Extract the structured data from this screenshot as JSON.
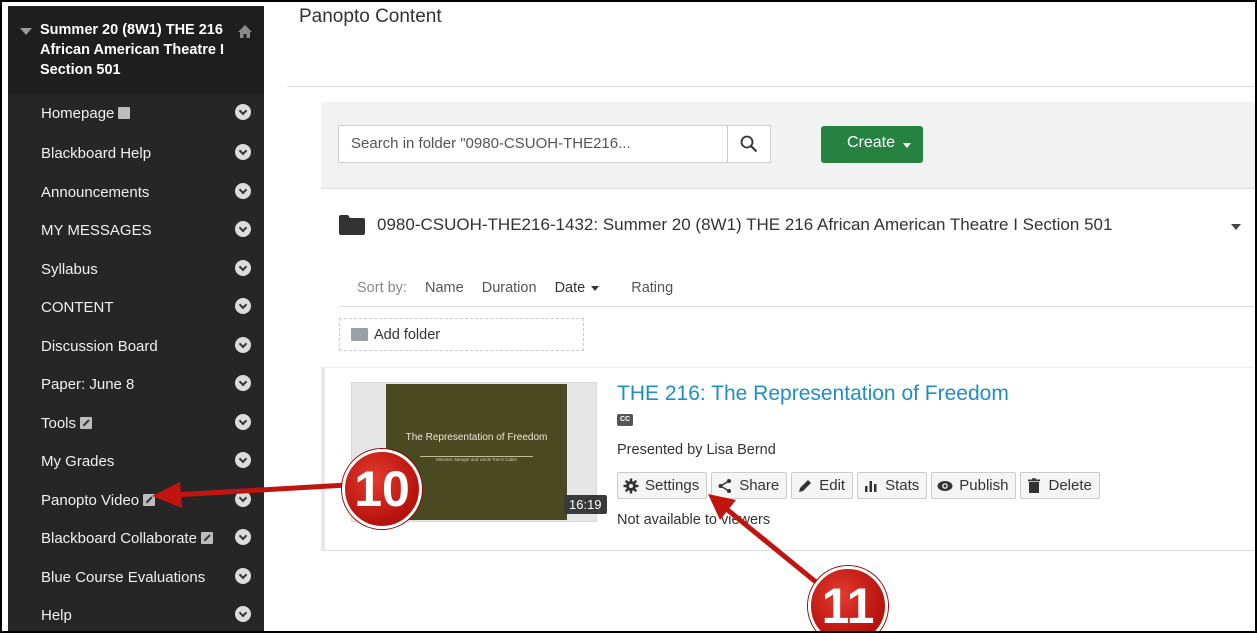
{
  "sidebar": {
    "course_title": "Summer 20 (8W1) THE 216 African American Theatre I Section 501",
    "items": [
      {
        "label": "Homepage",
        "icon": "page-icon"
      },
      {
        "label": "Blackboard Help"
      },
      {
        "label": "Announcements"
      },
      {
        "label": "MY MESSAGES"
      },
      {
        "label": "Syllabus"
      },
      {
        "label": "CONTENT"
      },
      {
        "label": "Discussion Board"
      },
      {
        "label": "Paper: June 8"
      },
      {
        "label": "Tools",
        "icon": "external-link-icon"
      },
      {
        "label": "My Grades"
      },
      {
        "label": "Panopto Video",
        "icon": "external-link-icon"
      },
      {
        "label": "Blackboard Collaborate",
        "icon": "external-link-icon"
      },
      {
        "label": "Blue Course Evaluations"
      },
      {
        "label": "Help"
      }
    ]
  },
  "main": {
    "heading": "Panopto Content",
    "search": {
      "placeholder": "Search in folder \"0980-CSUOH-THE216..."
    },
    "create_label": "Create",
    "folder_name": "0980-CSUOH-THE216-1432: Summer 20 (8W1) THE 216 African American Theatre I Section 501",
    "sort": {
      "label": "Sort by:",
      "options": [
        "Name",
        "Duration",
        "Date",
        "Rating"
      ],
      "active": "Date"
    },
    "add_folder_label": "Add folder",
    "session": {
      "title": "THE 216: The Representation of Freedom",
      "cc_label": "CC",
      "presenter": "Presented by Lisa Bernd",
      "duration": "16:19",
      "slide_title": "The Representation of Freedom",
      "slide_subtitle": "Minstrel, Manger and Uncle Tom's Cabin",
      "actions": [
        "Settings",
        "Share",
        "Edit",
        "Stats",
        "Publish",
        "Delete"
      ],
      "availability": "Not available to viewers"
    }
  },
  "annotations": {
    "badge_10": "10",
    "badge_11": "11",
    "arrow_color": "#c0140f"
  }
}
